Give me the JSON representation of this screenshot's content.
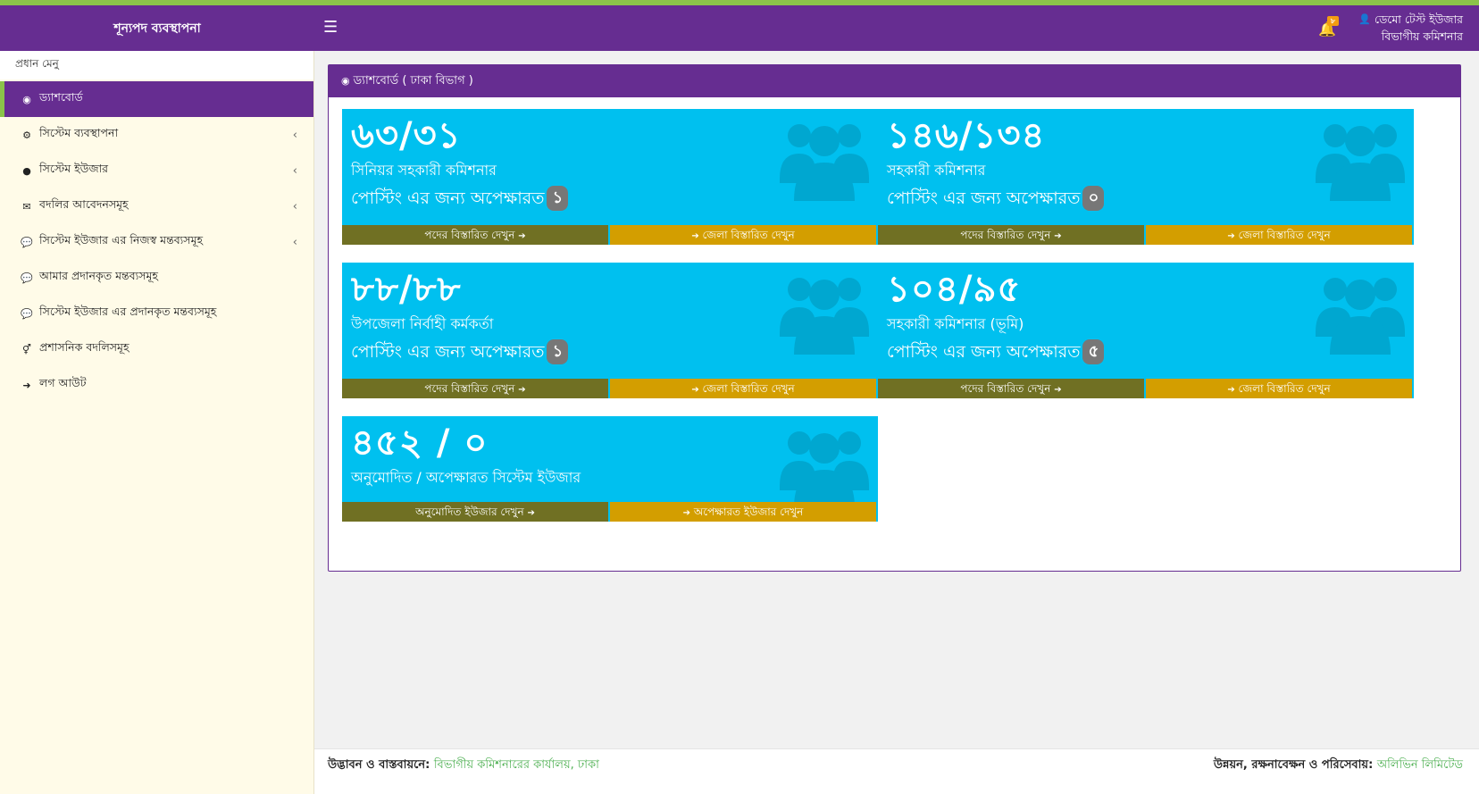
{
  "app": {
    "title": "শূন্যপদ ব্যবস্থাপনা"
  },
  "colors": {
    "header": "#662d91",
    "topline": "#8bc34a",
    "card": "#00c0ef",
    "footer_left": "#707023",
    "footer_right": "#d39e00",
    "badge": "#777777",
    "link": "#4caf50"
  },
  "header": {
    "menu_icon": "☰",
    "notifications": {
      "icon": "bell-icon",
      "count": "৮"
    },
    "user": {
      "name": "ডেমো টেস্ট ইউজার",
      "role": "বিভাগীয় কমিশনার"
    }
  },
  "sidebar": {
    "header": "প্রধান মেনু",
    "items": [
      {
        "label": "ড্যাশবোর্ড",
        "icon": "◉"
      },
      {
        "label": "সিস্টেম ব্যবস্থাপনা",
        "icon": "⚙"
      },
      {
        "label": "সিস্টেম ইউজার",
        "icon": "●"
      },
      {
        "label": "বদলির আবেদনসমূহ",
        "icon": "✉"
      },
      {
        "label": "সিস্টেম ইউজার এর নিজস্ব মন্তব্যসমূহ",
        "icon": "💬"
      },
      {
        "label": "আমার প্রদানকৃত মন্তব্যসমূহ",
        "icon": "💬"
      },
      {
        "label": "সিস্টেম ইউজার এর প্রদানকৃত মন্তব্যসমূহ",
        "icon": "💬"
      },
      {
        "label": "প্রশাসনিক বদলিসমূহ",
        "icon": "⚥"
      },
      {
        "label": "লগ আউট",
        "icon": "➜"
      }
    ]
  },
  "panel": {
    "title": "ড্যাশবোর্ড ( ঢাকা বিভাগ )"
  },
  "cards": [
    {
      "number": "৬৩/৩১",
      "post": "সিনিয়র সহকারী কমিশনার",
      "waiting": "পোস্টিং এর জন্য অপেক্ষারত",
      "badge": "১",
      "left_link": "পদের বিস্তারিত দেখুন",
      "right_link": "জেলা বিস্তারিত দেখুন"
    },
    {
      "number": "১৪৬/১৩৪",
      "post": "সহকারী কমিশনার",
      "waiting": "পোস্টিং এর জন্য অপেক্ষারত",
      "badge": "০",
      "left_link": "পদের বিস্তারিত দেখুন",
      "right_link": "জেলা বিস্তারিত দেখুন"
    },
    {
      "number": "৮৮/৮৮",
      "post": "উপজেলা নির্বাহী কর্মকর্তা",
      "waiting": "পোস্টিং এর জন্য অপেক্ষারত",
      "badge": "১",
      "left_link": "পদের বিস্তারিত দেখুন",
      "right_link": "জেলা বিস্তারিত দেখুন"
    },
    {
      "number": "১০৪/৯৫",
      "post": "সহকারী কমিশনার (ভূমি)",
      "waiting": "পোস্টিং এর জন্য অপেক্ষারত",
      "badge": "৫",
      "left_link": "পদের বিস্তারিত দেখুন",
      "right_link": "জেলা বিস্তারিত দেখুন"
    },
    {
      "number": "৪৫২ / ০",
      "post": "অনুমোদিত / অপেক্ষারত সিস্টেম ইউজার",
      "left_link": "অনুমোদিত ইউজার দেখুন",
      "right_link": "অপেক্ষারত ইউজার দেখুন"
    }
  ],
  "footer": {
    "left_prefix": "উদ্ভাবন ও বাস্তবায়নে:",
    "left_link": "বিভাগীয় কমিশনারের কার্যালয়, ঢাকা",
    "right_prefix": "উন্নয়ন, রক্ষনাবেক্ষন ও পরিসেবায়:",
    "right_link": "অলিভিন লিমিটেড"
  }
}
